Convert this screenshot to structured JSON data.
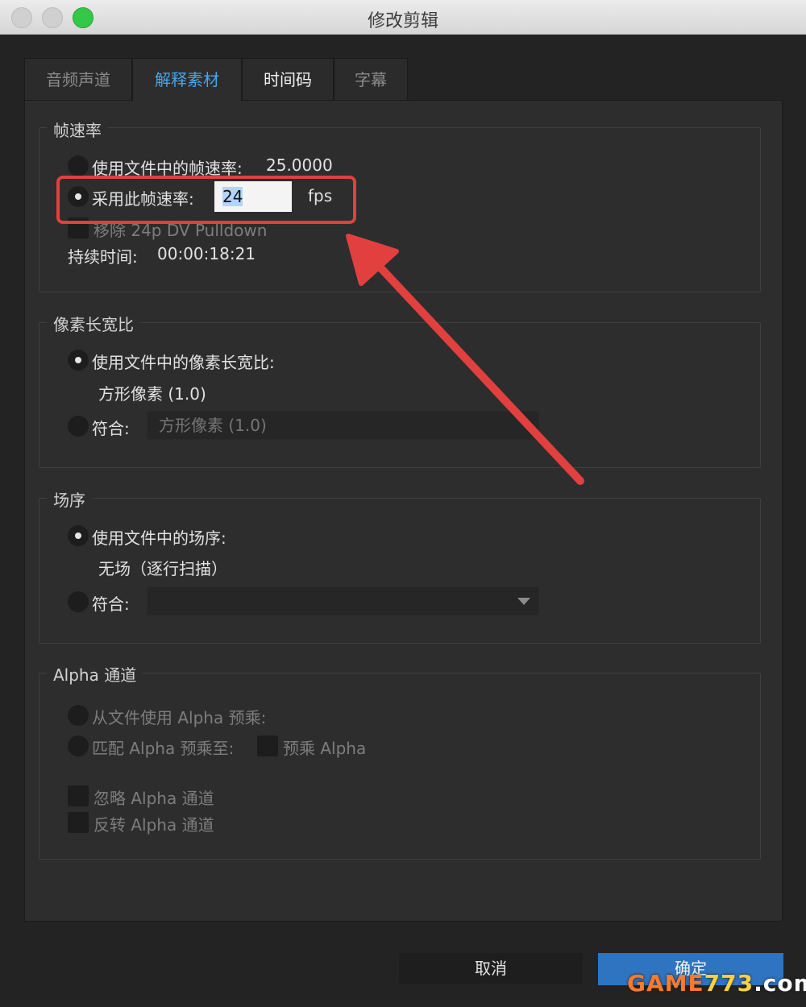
{
  "window": {
    "title": "修改剪辑"
  },
  "tabs": [
    {
      "label": "音频声道"
    },
    {
      "label": "解释素材"
    },
    {
      "label": "时间码"
    },
    {
      "label": "字幕"
    }
  ],
  "frame_rate": {
    "heading": "帧速率",
    "use_file_label": "使用文件中的帧速率:",
    "file_rate": "25.0000",
    "assume_label": "采用此帧速率:",
    "assume_value": "24",
    "assume_unit": "fps",
    "pulldown_label": "移除 24p DV Pulldown",
    "duration_label": "持续时间:",
    "duration_value": "00:00:18:21"
  },
  "pixel_aspect": {
    "heading": "像素长宽比",
    "use_file_label": "使用文件中的像素长宽比:",
    "file_value": "方形像素 (1.0)",
    "conform_label": "符合:",
    "conform_value": "方形像素 (1.0)"
  },
  "field_order": {
    "heading": "场序",
    "use_file_label": "使用文件中的场序:",
    "file_value": "无场（逐行扫描）",
    "conform_label": "符合:",
    "conform_value": ""
  },
  "alpha": {
    "heading": "Alpha 通道",
    "from_file_label": "从文件使用 Alpha 预乘:",
    "match_label": "匹配 Alpha 预乘至:",
    "premultiply_label": "预乘 Alpha",
    "ignore_label": "忽略 Alpha 通道",
    "invert_label": "反转 Alpha 通道"
  },
  "buttons": {
    "cancel": "取消",
    "ok": "确定"
  },
  "watermark": {
    "part1": "GAME",
    "part2": "773",
    "part3": ".com"
  },
  "colors": {
    "accent_tab": "#4aa5e6",
    "annotation": "#e1403f",
    "ok_button": "#2f74c0"
  }
}
